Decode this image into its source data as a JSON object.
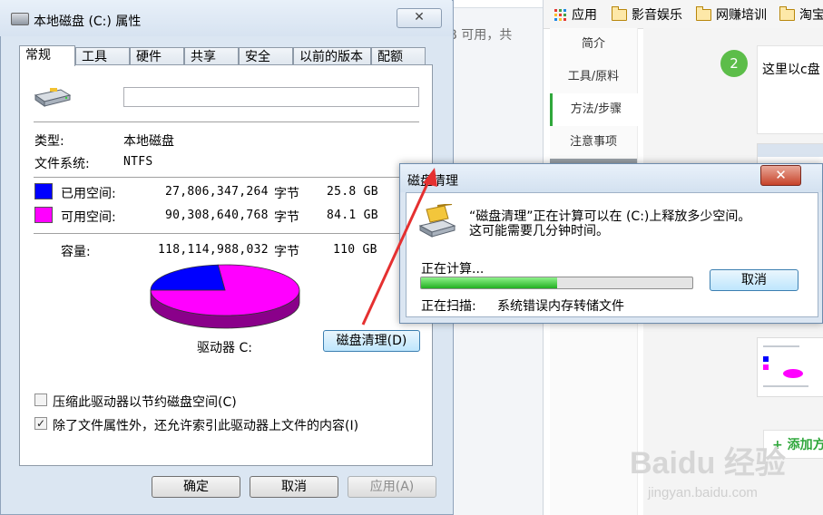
{
  "background_explorer": {
    "free_space_fragment": "4 GB 可用，共"
  },
  "browser": {
    "bookmarks": [
      {
        "label": "应用",
        "icon": "apps-grid-icon"
      },
      {
        "label": "影音娱乐",
        "icon": "folder-icon"
      },
      {
        "label": "网赚培训",
        "icon": "folder-icon"
      },
      {
        "label": "淘宝",
        "icon": "folder-icon"
      }
    ],
    "side_nav": [
      "简介",
      "工具/原料",
      "方法/步骤",
      "注意事项",
      "",
      ""
    ],
    "active_nav_index": 2,
    "step_number": "2",
    "step_text": "这里以c盘",
    "add_button": "+ 添加方",
    "watermark_brand": "Baidu 经验",
    "watermark_url": "jingyan.baidu.com"
  },
  "properties_dialog": {
    "title": "本地磁盘 (C:) 属性",
    "close_glyph": "✕",
    "tabs": [
      "常规",
      "工具",
      "硬件",
      "共享",
      "安全",
      "以前的版本",
      "配额"
    ],
    "active_tab_index": 0,
    "name_value": "",
    "type_label": "类型:",
    "type_value": "本地磁盘",
    "fs_label": "文件系统:",
    "fs_value": "NTFS",
    "used": {
      "label": "已用空间:",
      "bytes": "27,806,347,264",
      "unit": "字节",
      "size": "25.8 GB",
      "color": "#0000ff"
    },
    "free": {
      "label": "可用空间:",
      "bytes": "90,308,640,768",
      "unit": "字节",
      "size": "84.1 GB",
      "color": "#ff00ff"
    },
    "capacity": {
      "label": "容量:",
      "bytes": "118,114,988,032",
      "unit": "字节",
      "size": "110 GB"
    },
    "used_fraction": 0.235,
    "drive_label": "驱动器 C:",
    "cleanup_button": "磁盘清理(D)",
    "compress_checkbox": {
      "label": "压缩此驱动器以节约磁盘空间(C)",
      "checked": false
    },
    "index_checkbox": {
      "label": "除了文件属性外，还允许索引此驱动器上文件的内容(I)",
      "checked": true
    },
    "ok_button": "确定",
    "cancel_button": "取消",
    "apply_button": "应用(A)"
  },
  "cleanup_dialog": {
    "title": "磁盘清理",
    "close_glyph": "✕",
    "message_line1": "“磁盘清理”正在计算可以在 (C:)上释放多少空间。",
    "message_line2": "这可能需要几分钟时间。",
    "status": "正在计算...",
    "progress": 0.5,
    "cancel_button": "取消",
    "scan_label": "正在扫描:",
    "scan_item": "系统错误内存转储文件"
  },
  "colors": {
    "annotation_arrow": "#e53030",
    "accent_green": "#5cbd49"
  }
}
